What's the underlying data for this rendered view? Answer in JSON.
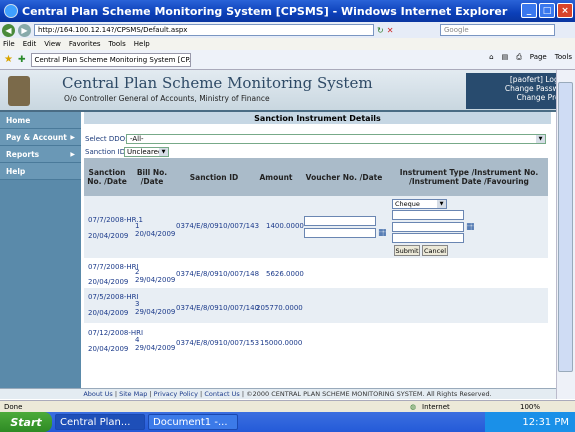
{
  "window": {
    "title": "Central Plan Scheme Monitoring System [CPSMS] - Windows Internet Explorer"
  },
  "address": {
    "url": "http://164.100.12.14?/CPSMS/Default.aspx",
    "search_placeholder": "Google"
  },
  "menu": [
    "File",
    "Edit",
    "View",
    "Favorites",
    "Tools",
    "Help"
  ],
  "tab": {
    "label": "Central Plan Scheme Monitoring System [CP..."
  },
  "toolbar": {
    "page": "Page",
    "tools": "Tools"
  },
  "header": {
    "app_name": "Central Plan Scheme Monitoring System",
    "subtitle": "O/o Controller General of Accounts, Ministry of Finance"
  },
  "user": {
    "name": "[paofert] Logout",
    "change_password": "Change Password",
    "change_profile": "Change Profile"
  },
  "nav": [
    {
      "label": "Home",
      "arrow": ""
    },
    {
      "label": "Pay & Account",
      "arrow": "▶"
    },
    {
      "label": "Reports",
      "arrow": "▶"
    },
    {
      "label": "Help",
      "arrow": ""
    }
  ],
  "section_title": "Sanction Instrument Details",
  "filters": {
    "ddo_label": "Select DDO:",
    "ddo_value": "-All-",
    "sanction_label": "Sanction ID:",
    "sanction_value": "Uncleared"
  },
  "table": {
    "headers": [
      "Sanction No. /Date",
      "Bill No. /Date",
      "Sanction ID",
      "Amount",
      "Voucher No. /Date",
      "Instrument Type /Instrument No. /Instrument Date /Favouring"
    ],
    "rows": [
      {
        "sanction": "07/7/2008-HR.1",
        "sanction_date": "20/04/2009",
        "bill": "1",
        "bill_date": "20/04/2009",
        "sanction_id": "0374/E/8/0910/007/143",
        "amount": "1400.0000"
      },
      {
        "sanction": "07/7/2008-HRI",
        "sanction_date": "20/04/2009",
        "bill": "2",
        "bill_date": "29/04/2009",
        "sanction_id": "0374/E/8/0910/007/148",
        "amount": "5626.0000"
      },
      {
        "sanction": "07/5/2008-HRI",
        "sanction_date": "20/04/2009",
        "bill": "3",
        "bill_date": "29/04/2009",
        "sanction_id": "0374/E/8/0910/007/140",
        "amount": "205770.0000"
      },
      {
        "sanction": "07/12/2008-HRI",
        "sanction_date": "20/04/2009",
        "bill": "4",
        "bill_date": "29/04/2009",
        "sanction_id": "0374/E/8/0910/007/153",
        "amount": "15000.0000"
      }
    ],
    "instrument_type": "Cheque",
    "submit_label": "Submit",
    "cancel_label": "Cancel"
  },
  "footer": {
    "about": "About Us",
    "sitemap": "Site Map",
    "privacy": "Privacy Policy",
    "contact": "Contact Us",
    "copyright": "©2000 CENTRAL PLAN SCHEME MONITORING SYSTEM. All Rights Reserved."
  },
  "status": {
    "text": "Done",
    "zone": "Internet",
    "zoom": "100%"
  },
  "taskbar": {
    "start": "Start",
    "task1": "Central Plan...",
    "task2": "Document1 -...",
    "time": "12:31 PM"
  }
}
